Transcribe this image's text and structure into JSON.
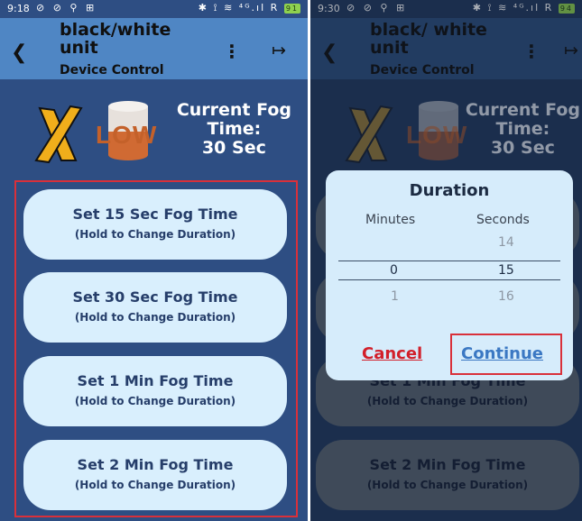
{
  "left": {
    "status": {
      "time": "9:18",
      "icons": "⊘ ⊘ ⚲ ⊞",
      "right": "✱ ⟟ ≋ ⁴ᴳ.ıl R",
      "battery": "91"
    },
    "appbar": {
      "title": "black/white\nunit",
      "subtitle": "Device Control"
    },
    "fog": {
      "level": "LOW",
      "line1": "Current Fog",
      "line2": "Time:",
      "line3": "30 Sec"
    },
    "buttons": [
      {
        "label": "Set 15 Sec Fog Time",
        "hint": "(Hold to Change Duration)"
      },
      {
        "label": "Set 30 Sec Fog Time",
        "hint": "(Hold to Change Duration)"
      },
      {
        "label": "Set 1 Min Fog Time",
        "hint": "(Hold to Change Duration)"
      },
      {
        "label": "Set 2 Min Fog Time",
        "hint": "(Hold to Change Duration)"
      }
    ]
  },
  "right": {
    "status": {
      "time": "9:30",
      "icons": "⊘ ⊘ ⚲ ⊞",
      "right": "✱ ⟟ ≋ ⁴ᴳ.ıl R",
      "battery": "94"
    },
    "appbar": {
      "title": "black/ white\nunit",
      "subtitle": "Device Control"
    },
    "fog": {
      "level": "LOW",
      "line1": "Current Fog",
      "line2": "Time:",
      "line3": "30 Sec"
    },
    "buttons": [
      {
        "label": "Set 1 Min Fog Time",
        "hint": "(Hold to Change Duration)"
      },
      {
        "label": "Set 2 Min Fog Time",
        "hint": "(Hold to Change Duration)"
      }
    ],
    "dialog": {
      "title": "Duration",
      "minutes_header": "Minutes",
      "seconds_header": "Seconds",
      "seconds_above": "14",
      "minutes_selected": "0",
      "seconds_selected": "15",
      "minutes_below": "1",
      "seconds_below": "16",
      "cancel": "Cancel",
      "continue": "Continue"
    }
  },
  "colors": {
    "left_bg": "#2e4e83",
    "appbar": "#4f86c4",
    "button_bg": "#d9effd",
    "highlight_border": "#d9303a",
    "cancel": "#d21f2a",
    "continue": "#3b78c3"
  },
  "icons": {
    "back": "chevron-left-icon",
    "menu": "more-vertical-icon",
    "exit": "exit-icon",
    "fog_off": "x-mark-icon",
    "fog_level": "cylinder-icon"
  }
}
